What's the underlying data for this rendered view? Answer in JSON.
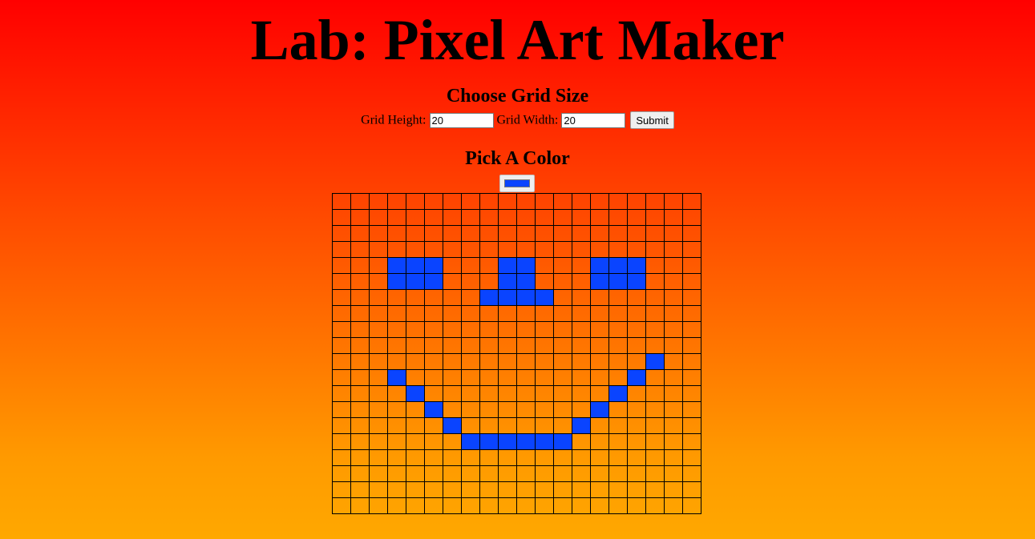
{
  "title": "Lab: Pixel Art Maker",
  "grid_form": {
    "heading": "Choose Grid Size",
    "height_label": "Grid Height:",
    "height_value": "20",
    "width_label": "Grid Width:",
    "width_value": "20",
    "submit_label": "Submit"
  },
  "color_section": {
    "heading": "Pick A Color",
    "selected_color": "#0a44ff"
  },
  "canvas": {
    "rows": 20,
    "cols": 20,
    "fill_color": "#0a44ff",
    "filled_cells": [
      [
        4,
        3
      ],
      [
        4,
        4
      ],
      [
        4,
        5
      ],
      [
        4,
        9
      ],
      [
        4,
        10
      ],
      [
        4,
        14
      ],
      [
        4,
        15
      ],
      [
        4,
        16
      ],
      [
        5,
        3
      ],
      [
        5,
        4
      ],
      [
        5,
        5
      ],
      [
        5,
        9
      ],
      [
        5,
        10
      ],
      [
        5,
        14
      ],
      [
        5,
        15
      ],
      [
        5,
        16
      ],
      [
        6,
        8
      ],
      [
        6,
        9
      ],
      [
        6,
        10
      ],
      [
        6,
        11
      ],
      [
        10,
        17
      ],
      [
        11,
        3
      ],
      [
        11,
        16
      ],
      [
        12,
        4
      ],
      [
        12,
        15
      ],
      [
        13,
        5
      ],
      [
        13,
        14
      ],
      [
        14,
        6
      ],
      [
        14,
        13
      ],
      [
        15,
        7
      ],
      [
        15,
        8
      ],
      [
        15,
        9
      ],
      [
        15,
        10
      ],
      [
        15,
        11
      ],
      [
        15,
        12
      ]
    ]
  }
}
